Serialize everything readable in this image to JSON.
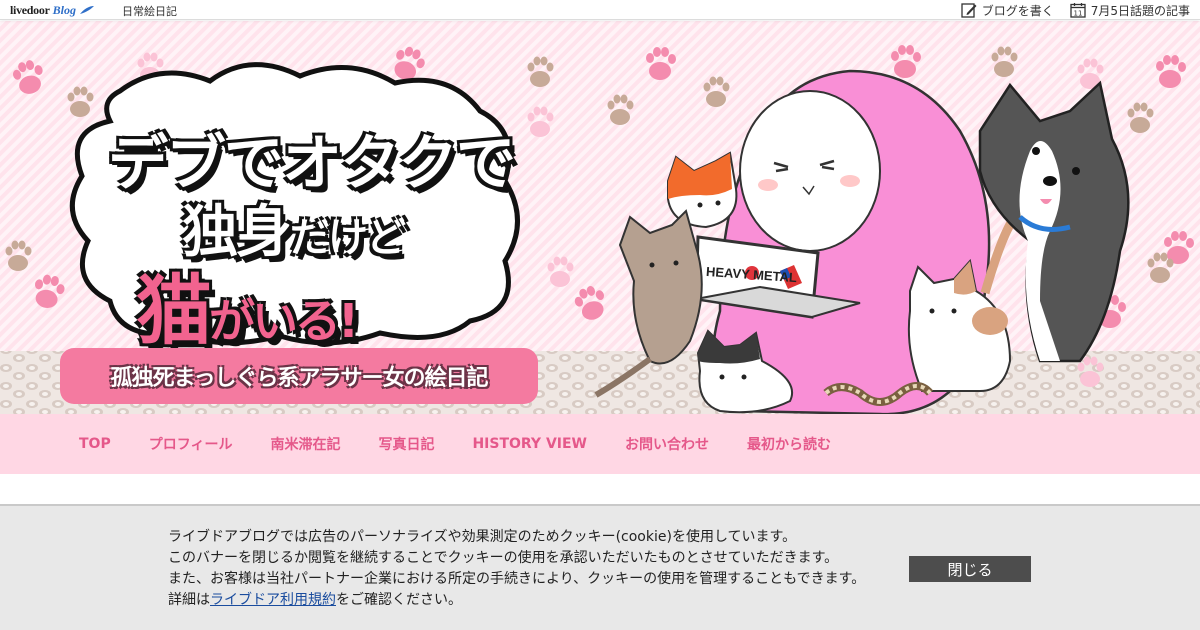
{
  "topbar": {
    "logo_text": "livedoor",
    "logo_blog": "Blog",
    "blog_name": "日常絵日記",
    "write_blog": "ブログを書く",
    "calendar_day": "11",
    "topic_link": "7月5日話題の記事"
  },
  "header": {
    "title_line1_a": "デブで",
    "title_line1_b": "オタクで",
    "title_line2_a": "独身",
    "title_line2_b": "だけど",
    "title_line3_a": "猫",
    "title_line3_b": "がいる!",
    "subtitle": "孤独死まっしぐら系アラサー女の絵日記",
    "laptop_sticker": "HEAVY METAL"
  },
  "nav": {
    "items": [
      "TOP",
      "プロフィール",
      "南米滞在記",
      "写真日記",
      "HISTORY VIEW",
      "お問い合わせ",
      "最初から読む"
    ]
  },
  "cookie": {
    "line1": "ライブドアブログでは広告のパーソナライズや効果測定のためクッキー(cookie)を使用しています。",
    "line2": "このバナーを閉じるか閲覧を継続することでクッキーの使用を承認いただいたものとさせていただきます。",
    "line3": "また、お客様は当社パートナー企業における所定の手続きにより、クッキーの使用を管理することもできます。",
    "line4_prefix": "詳細は",
    "line4_link": "ライブドア利用規約",
    "line4_suffix": "をご確認ください。",
    "close_label": "閉じる"
  },
  "colors": {
    "nav_bg": "#ffd7e4",
    "nav_text": "#e5588a",
    "header_bg": "#fdf2f6",
    "accent_pink": "#f2638f",
    "cookie_bg": "#e8e8e8",
    "close_button_bg": "#4d4d4d"
  }
}
